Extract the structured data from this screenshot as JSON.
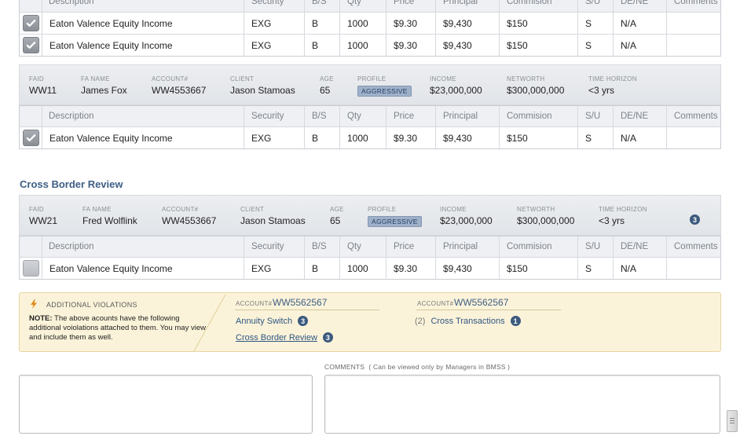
{
  "columns": {
    "description": "Description",
    "security": "Security",
    "bs": "B/S",
    "qty": "Qty",
    "price": "Price",
    "principal": "Principal",
    "commission": "Commision",
    "su": "S/U",
    "dene": "DE/NE",
    "comments": "Comments"
  },
  "info_labels": {
    "faid": "FAID",
    "fa_name": "FA NAME",
    "account": "ACCOUNT#",
    "client": "CLIENT",
    "age": "AGE",
    "profile": "PROFILE",
    "income": "INCOME",
    "networth": "NETWORTH",
    "time_horizon": "TIME HORIZON"
  },
  "top_trades": [
    {
      "checked": true,
      "description": "Eaton Valence Equity Income",
      "security": "EXG",
      "bs": "B",
      "qty": "1000",
      "price": "$9.30",
      "principal": "$9,430",
      "commission": "$150",
      "su": "S",
      "dene": "N/A",
      "comments": ""
    },
    {
      "checked": true,
      "description": "Eaton Valence Equity Income",
      "security": "EXG",
      "bs": "B",
      "qty": "1000",
      "price": "$9.30",
      "principal": "$9,430",
      "commission": "$150",
      "su": "S",
      "dene": "N/A",
      "comments": ""
    }
  ],
  "group2": {
    "faid": "WW11",
    "fa_name": "James Fox",
    "account": "WW4553667",
    "client": "Jason Stamoas",
    "age": "65",
    "profile": "AGGRESSIVE",
    "income": "$23,000,000",
    "networth": "$300,000,000",
    "time_horizon": "<3 yrs",
    "trades": [
      {
        "checked": true,
        "description": "Eaton Valence Equity Income",
        "security": "EXG",
        "bs": "B",
        "qty": "1000",
        "price": "$9.30",
        "principal": "$9,430",
        "commission": "$150",
        "su": "S",
        "dene": "N/A",
        "comments": ""
      }
    ]
  },
  "cross_border": {
    "title": "Cross Border Review",
    "faid": "WW21",
    "fa_name": "Fred Wolflink",
    "account": "WW4553667",
    "client": "Jason Stamoas",
    "age": "65",
    "profile": "AGGRESSIVE",
    "income": "$23,000,000",
    "networth": "$300,000,000",
    "time_horizon": "<3 yrs",
    "count": "3",
    "trades": [
      {
        "checked": false,
        "description": "Eaton Valence Equity Income",
        "security": "EXG",
        "bs": "B",
        "qty": "1000",
        "price": "$9.30",
        "principal": "$9,430",
        "commission": "$150",
        "su": "S",
        "dene": "N/A",
        "comments": ""
      }
    ]
  },
  "violations": {
    "title": "ADDITIONAL VIOLATIONS",
    "note_bold": "NOTE:",
    "note_text": " The above acounts have the following additional voiolations attached to them. You may view and include them as well.",
    "accounts": [
      {
        "label": "ACCOUNT#",
        "value": "WW5562567",
        "links": [
          {
            "text": "Annuity Switch",
            "count": "3"
          },
          {
            "text": "Cross Border Review",
            "count": "3"
          }
        ]
      },
      {
        "label": "ACCOUNT#",
        "value": "WW5562567",
        "number": "(2)",
        "links": [
          {
            "text": "Cross Transactions",
            "count": "1"
          }
        ]
      }
    ]
  },
  "comments": {
    "label": "COMMENTS",
    "note": "( Can be viewed only by Managers in BMSS )"
  },
  "colors": {
    "accent": "#3e5e86",
    "badge": "#3c5a7e",
    "violation_bg": "#fbf3d9",
    "aggressive_badge": "#9fb1c9"
  },
  "icons": {
    "check": "check-icon",
    "warning": "lightning-icon",
    "count": "count-badge"
  }
}
